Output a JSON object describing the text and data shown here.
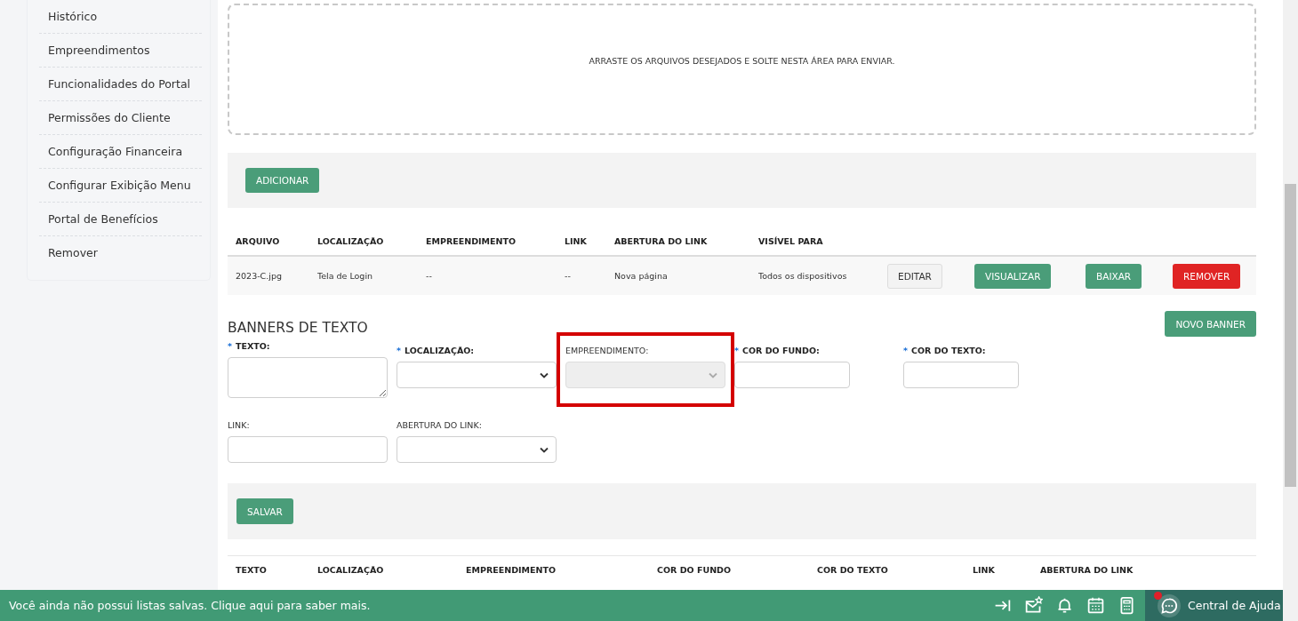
{
  "sidebar": {
    "items": [
      {
        "label": "Histórico"
      },
      {
        "label": "Empreendimentos"
      },
      {
        "label": "Funcionalidades do Portal"
      },
      {
        "label": "Permissões do Cliente"
      },
      {
        "label": "Configuração Financeira"
      },
      {
        "label": "Configurar Exibição Menu"
      },
      {
        "label": "Portal de Benefícios"
      },
      {
        "label": "Remover"
      }
    ]
  },
  "upload": {
    "dropzone_text": "ARRASTE OS ARQUIVOS DESEJADOS E SOLTE NESTA ÁREA PARA ENVIAR.",
    "add_button": "ADICIONAR"
  },
  "image_banners": {
    "columns": [
      "ARQUIVO",
      "LOCALIZAÇÃO",
      "EMPREENDIMENTO",
      "LINK",
      "ABERTURA DO LINK",
      "VISÍVEL PARA"
    ],
    "rows": [
      {
        "cells": [
          "2023-C.jpg",
          "Tela de Login",
          "--",
          "--",
          "Nova página",
          "Todos os dispositivos"
        ],
        "actions": [
          {
            "label": "EDITAR",
            "kind": "default"
          },
          {
            "label": "VISUALIZAR",
            "kind": "primary"
          },
          {
            "label": "BAIXAR",
            "kind": "primary"
          },
          {
            "label": "REMOVER",
            "kind": "danger"
          }
        ]
      }
    ]
  },
  "text_banners": {
    "title": "BANNERS DE TEXTO",
    "new_button": "NOVO BANNER",
    "form_rows": [
      [
        {
          "label": "TEXTO:",
          "kind": "textarea",
          "required": true,
          "required_mark": "*",
          "disabled": false,
          "highlighted": false
        },
        {
          "label": "LOCALIZAÇÃO:",
          "kind": "select",
          "required": true,
          "required_mark": "*",
          "disabled": false,
          "highlighted": false
        },
        {
          "label": "EMPREENDIMENTO:",
          "kind": "select",
          "required": false,
          "disabled": true,
          "highlighted": true
        },
        {
          "label": "COR DO FUNDO:",
          "kind": "input",
          "required": true,
          "required_mark": "*",
          "disabled": false,
          "highlighted": false
        },
        {
          "label": "COR DO TEXTO:",
          "kind": "input",
          "required": true,
          "required_mark": "*",
          "disabled": false,
          "highlighted": false
        }
      ],
      [
        {
          "label": "LINK:",
          "kind": "wide-input",
          "required": false,
          "disabled": false,
          "highlighted": false
        },
        {
          "label": "ABERTURA DO LINK:",
          "kind": "select",
          "required": false,
          "disabled": false,
          "highlighted": false
        }
      ]
    ],
    "save_button": "SALVAR",
    "columns": [
      "TEXTO",
      "LOCALIZAÇÃO",
      "EMPREENDIMENTO",
      "COR DO FUNDO",
      "COR DO TEXTO",
      "LINK",
      "ABERTURA DO LINK"
    ]
  },
  "footer": {
    "message": "Você ainda não possui listas salvas. Clique aqui para saber mais.",
    "help": {
      "label": "Central de Ajuda",
      "notification": true
    }
  }
}
